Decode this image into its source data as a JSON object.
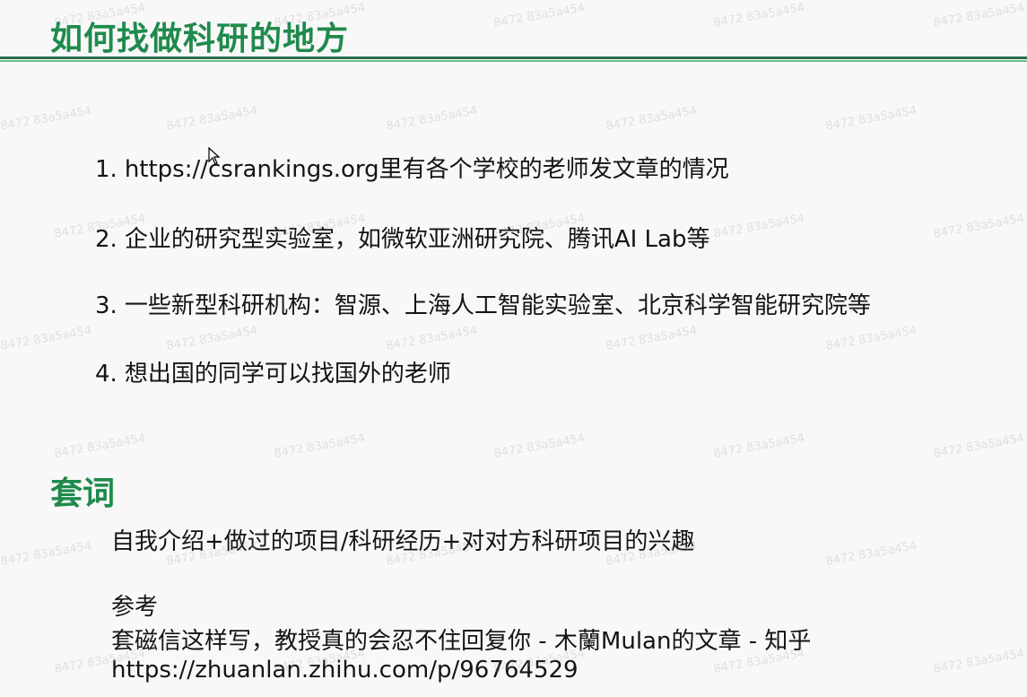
{
  "slide": {
    "title": "如何找做科研的地方",
    "list": [
      {
        "num": "1.",
        "text": "https://csrankings.org里有各个学校的老师发文章的情况"
      },
      {
        "num": "2.",
        "text": "企业的研究型实验室，如微软亚洲研究院、腾讯AI Lab等"
      },
      {
        "num": "3.",
        "text": "一些新型科研机构：智源、上海人工智能实验室、北京科学智能研究院等"
      },
      {
        "num": "4.",
        "text": "想出国的同学可以找国外的老师"
      }
    ],
    "subtitle": "套词",
    "intro": "自我介绍+做过的项目/科研经历+对对方科研项目的兴趣",
    "reference": {
      "label": "参考",
      "text": "套磁信这样写，教授真的会忍不住回复你 - 木蘭Mulan的文章 - 知乎",
      "url": "https://zhuanlan.zhihu.com/p/96764529"
    },
    "watermark": "8472 83a5a454",
    "colors": {
      "accent": "#1f8a4c",
      "rule": "#2b6d4b"
    }
  }
}
